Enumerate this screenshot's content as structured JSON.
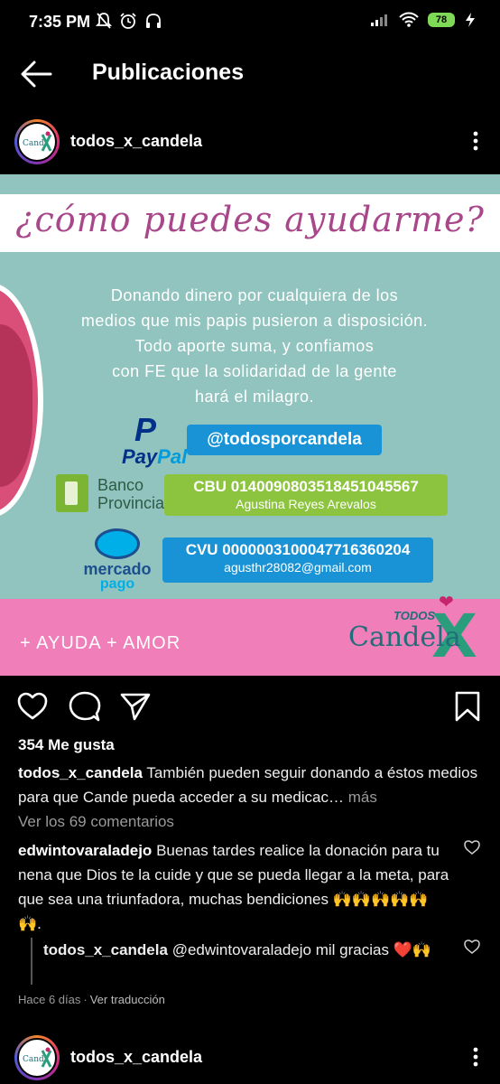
{
  "status_bar": {
    "time": "7:35 PM",
    "battery": "78"
  },
  "header": {
    "title": "Publicaciones"
  },
  "post": {
    "account": "todos_x_candela",
    "image": {
      "heading": "¿cómo puedes ayudarme?",
      "body_lines": [
        "Donando dinero por cualquiera de los",
        "medios que mis papis pusieron a disposición.",
        "Todo aporte suma, y confiamos",
        "con FE que la solidaridad de la gente",
        "hará el milagro."
      ],
      "paypal_word_a": "Pay",
      "paypal_word_b": "Pal",
      "paypal_mark": "P",
      "paypal_handle": "@todosporcandela",
      "banco_line1": "Banco",
      "banco_line2": "Provincia",
      "cbu": "CBU 0140090803518451045567",
      "cbu_holder": "Agustina Reyes Arevalos",
      "mp_line1": "mercado",
      "mp_line2": "pago",
      "cvu": "CVU 0000003100047716360204",
      "cvu_email": "agusthr28082@gmail.com",
      "tagline": "+ AYUDA + AMOR",
      "logo_todos": "TODOS",
      "logo_candela": "Candela",
      "logo_x": "X",
      "colors": {
        "teal_bg": "#91c4be",
        "heading_purple": "#a8478a",
        "pink_band": "#f07eb8",
        "paypal_blue": "#1a93d6",
        "banco_green": "#8dc43f"
      }
    },
    "likes": "354 Me gusta",
    "caption_text": "También pueden seguir donando a éstos medios para que Cande pueda acceder a su medicac…",
    "caption_more": "más",
    "view_comments": "Ver los 69 comentarios",
    "comment": {
      "user": "edwintovaraladejo",
      "text": "Buenas tardes realice la donación para tu nena que Dios te la cuide y que se pueda llegar a la meta, para que sea una triunfadora, muchas bendiciones 🙌🙌🙌🙌🙌🙌."
    },
    "reply": {
      "user": "todos_x_candela",
      "text": "@edwintovaraladejo mil gracias ❤️🙌"
    },
    "meta_time": "Hace 6 días",
    "meta_dot": "·",
    "meta_translate": "Ver traducción"
  },
  "next_post": {
    "account": "todos_x_candela"
  },
  "avatar_text": "TODOS Candela"
}
